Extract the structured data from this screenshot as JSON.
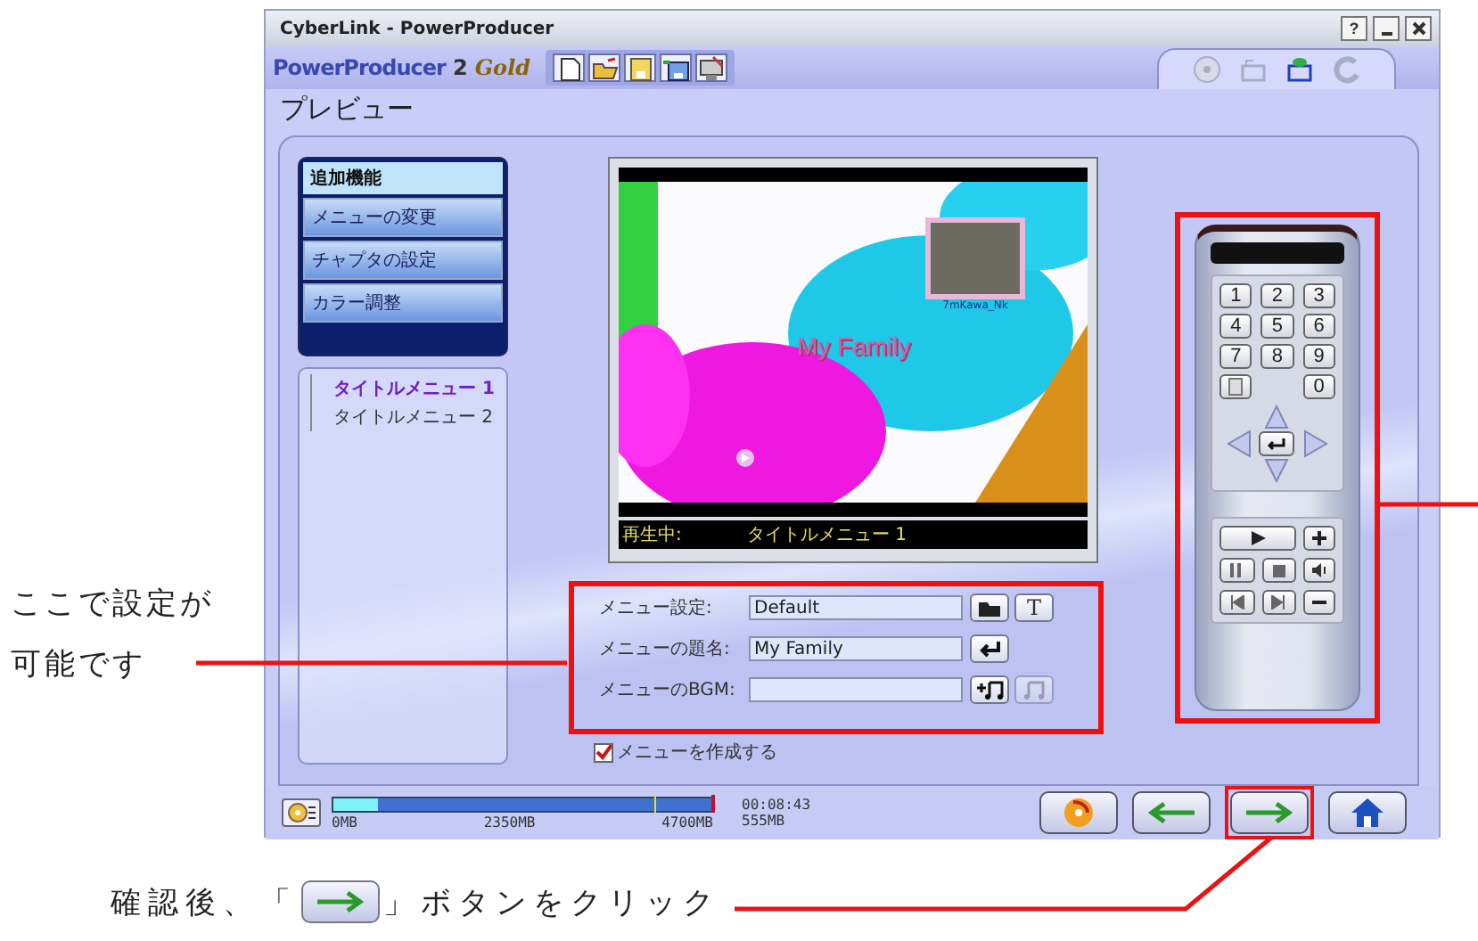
{
  "window": {
    "title": "CyberLink - PowerProducer",
    "help_button": "?"
  },
  "logo": {
    "name": "PowerProducer",
    "version": "2",
    "edition": "Gold"
  },
  "toolbar": [
    {
      "kind": "new"
    },
    {
      "kind": "open"
    },
    {
      "kind": "save"
    },
    {
      "kind": "save_as"
    },
    {
      "kind": "export"
    }
  ],
  "steps": [
    {
      "kind": "disc",
      "selected": false
    },
    {
      "kind": "edit",
      "selected": false
    },
    {
      "kind": "preview",
      "selected": true
    },
    {
      "kind": "burn",
      "selected": false
    }
  ],
  "page_title": "プレビュー",
  "feature_menu": {
    "header": "追加機能",
    "items": [
      {
        "label": "メニューの変更"
      },
      {
        "label": "チャプタの設定"
      },
      {
        "label": "カラー調整"
      }
    ]
  },
  "menu_tree": [
    {
      "label": "タイトルメニュー 1",
      "selected": true
    },
    {
      "label": "タイトルメニュー 2",
      "selected": false
    }
  ],
  "preview": {
    "menu_title": "My Family",
    "thumbnail_caption": "7mKawa_Nk",
    "status_label": "再生中:",
    "status_value": "タイトルメニュー 1"
  },
  "menu_settings": {
    "fields": [
      {
        "label": "メニュー設定:",
        "value": "Default",
        "buttons": [
          {
            "kind": "folder",
            "disabled": false
          },
          {
            "kind": "text",
            "label": "T",
            "disabled": false
          }
        ]
      },
      {
        "label": "メニューの題名:",
        "value": "My Family",
        "buttons": [
          {
            "kind": "enter",
            "disabled": false
          }
        ]
      },
      {
        "label": "メニューのBGM:",
        "buttons": [
          {
            "kind": "music_add",
            "disabled": false
          },
          {
            "kind": "music",
            "disabled": true
          }
        ]
      }
    ]
  },
  "create_menu": {
    "label": "メニューを作成する",
    "checked": true
  },
  "remote": {
    "number_keys": [
      "1",
      "2",
      "3",
      "4",
      "5",
      "6",
      "7",
      "8",
      "9"
    ],
    "zero_key": "0"
  },
  "disc_usage": {
    "level": 0.12,
    "labels": [
      "0MB",
      "2350MB",
      "4700MB"
    ],
    "duration": "00:08:43",
    "size": "555MB"
  },
  "nav_buttons": [
    {
      "kind": "burn",
      "highlighted": false
    },
    {
      "kind": "back",
      "highlighted": false
    },
    {
      "kind": "next",
      "highlighted": true
    },
    {
      "kind": "home",
      "highlighted": false
    }
  ],
  "callouts": {
    "settings": "ここで設定が可能です",
    "instruction_before": "確認後、「",
    "instruction_after": "」ボタンをクリック"
  }
}
